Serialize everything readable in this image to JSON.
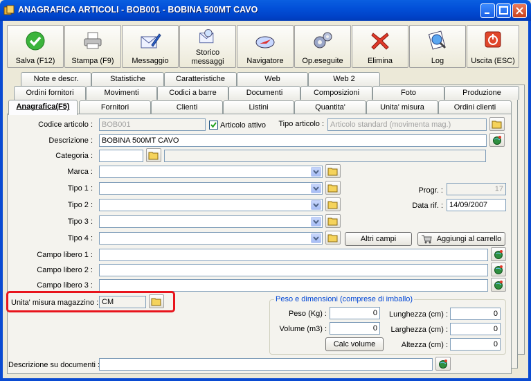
{
  "window": {
    "title": "ANAGRAFICA ARTICOLI - BOB001 - BOBINA 500MT CAVO"
  },
  "toolbar": {
    "save": "Salva (F12)",
    "print": "Stampa (F9)",
    "message": "Messaggio",
    "history_line1": "Storico",
    "history_line2": "messaggi",
    "navigator": "Navigatore",
    "ops_done": "Op.eseguite",
    "delete": "Elimina",
    "log": "Log",
    "exit": "Uscita (ESC)"
  },
  "tabs": {
    "row1": [
      "Note e descr.",
      "Statistiche",
      "Caratteristiche",
      "Web",
      "Web 2"
    ],
    "row2": [
      "Ordini fornitori",
      "Movimenti",
      "Codici a barre",
      "Documenti",
      "Composizioni",
      "Foto",
      "Produzione"
    ],
    "row3": [
      "Anagrafica(F5)",
      "Fornitori",
      "Clienti",
      "Listini",
      "Quantita'",
      "Unita' misura",
      "Ordini clienti"
    ]
  },
  "form": {
    "codice_label": "Codice articolo :",
    "codice_value": "BOB001",
    "attivo_label": "Articolo attivo",
    "tipo_articolo_label": "Tipo articolo :",
    "tipo_articolo_value": "Articolo standard (movimenta mag.)",
    "descrizione_label": "Descrizione :",
    "descrizione_value": "BOBINA 500MT CAVO",
    "categoria_label": "Categoria :",
    "categoria_value": "",
    "marca_label": "Marca :",
    "tipo1_label": "Tipo 1 :",
    "tipo2_label": "Tipo 2 :",
    "tipo3_label": "Tipo 3 :",
    "tipo4_label": "Tipo 4 :",
    "progr_label": "Progr. :",
    "progr_value": "17",
    "datarif_label": "Data rif. :",
    "datarif_value": "14/09/2007",
    "altri_campi": "Altri campi",
    "aggiungi_carrello": "Aggiungi al carrello",
    "campo1_label": "Campo libero 1 :",
    "campo2_label": "Campo libero 2 :",
    "campo3_label": "Campo libero 3 :",
    "um_label": "Unita' misura magazzino :",
    "um_value": "CM",
    "peso_group": "Peso e dimensioni (comprese di imballo)",
    "peso_label": "Peso (Kg) :",
    "peso_value": "0",
    "volume_label": "Volume (m3) :",
    "volume_value": "0",
    "calc_volume": "Calc volume",
    "lunghezza_label": "Lunghezza (cm) :",
    "lunghezza_value": "0",
    "larghezza_label": "Larghezza (cm) :",
    "larghezza_value": "0",
    "altezza_label": "Altezza (cm) :",
    "altezza_value": "0",
    "desc_doc_label": "Descrizione su documenti :",
    "desc_doc_value": ""
  },
  "colors": {
    "highlight": "#e8141c",
    "titlebar": "#0250d8",
    "group_title": "#0046d5"
  }
}
